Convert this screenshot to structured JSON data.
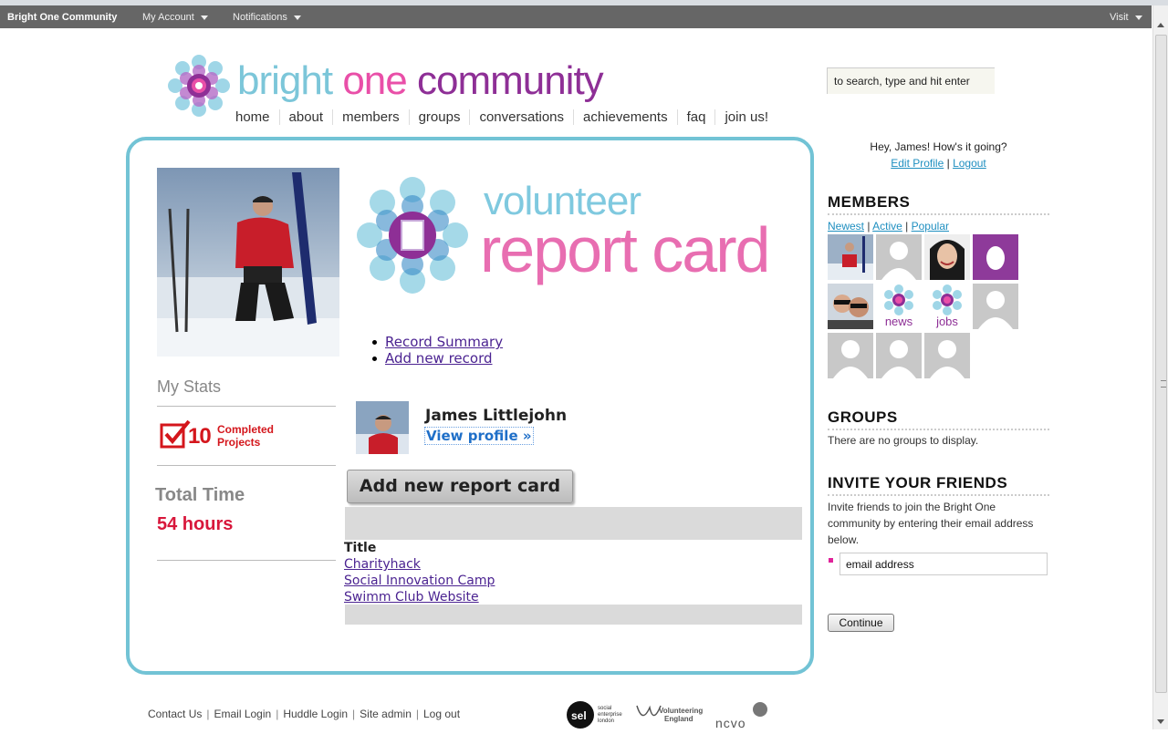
{
  "adminbar": {
    "brand": "Bright One Community",
    "my_account": "My Account",
    "notifications": "Notifications",
    "visit": "Visit"
  },
  "logo": {
    "word1": "bright",
    "word2": "one",
    "word3": "community"
  },
  "nav": [
    "home",
    "about",
    "members",
    "groups",
    "conversations",
    "achievements",
    "faq",
    "join us!"
  ],
  "search": {
    "placeholder": "to search, type and hit enter"
  },
  "stats": {
    "heading": "My Stats",
    "completed_count": "10",
    "completed_label_1": "Completed",
    "completed_label_2": "Projects",
    "total_time_label": "Total Time",
    "total_time_value": "54 hours"
  },
  "banner": {
    "line1": "volunteer",
    "line2": "report card"
  },
  "report_links": [
    "Record Summary",
    "Add new record"
  ],
  "user": {
    "name": "James Littlejohn",
    "view_profile": "View profile »"
  },
  "add_button": "Add new report card",
  "table": {
    "header": "Title",
    "rows": [
      "Charityhack",
      "Social Innovation Camp",
      "Swimm Club Website"
    ]
  },
  "sidebar": {
    "greeting": "Hey, James! How's it going?",
    "edit_profile": "Edit Profile",
    "logout": "Logout",
    "members_heading": "MEMBERS",
    "member_tabs": [
      "Newest",
      "Active",
      "Popular"
    ],
    "avatar_news": "news",
    "avatar_jobs": "jobs",
    "groups_heading": "GROUPS",
    "groups_empty": "There are no groups to display.",
    "invite_heading": "INVITE YOUR FRIENDS",
    "invite_text": "Invite friends to join the Bright One community by entering their email address below.",
    "email_value": "email address",
    "continue": "Continue"
  },
  "footer": {
    "links": [
      "Contact Us",
      "Email Login",
      "Huddle Login",
      "Site admin",
      "Log out"
    ],
    "sponsor_sel": "sel",
    "sponsor_sel_text_1": "social",
    "sponsor_sel_text_2": "enterprise",
    "sponsor_sel_text_3": "london",
    "sponsor_ve_1": "Volunteering",
    "sponsor_ve_2": "England",
    "sponsor_ncvo": "ncvo"
  },
  "colors": {
    "card_border": "#72c3d5",
    "accent_pink": "#e94fa8",
    "accent_purple": "#8e2f96",
    "accent_red": "#d4161c",
    "link_blue": "#1f8fc0"
  }
}
